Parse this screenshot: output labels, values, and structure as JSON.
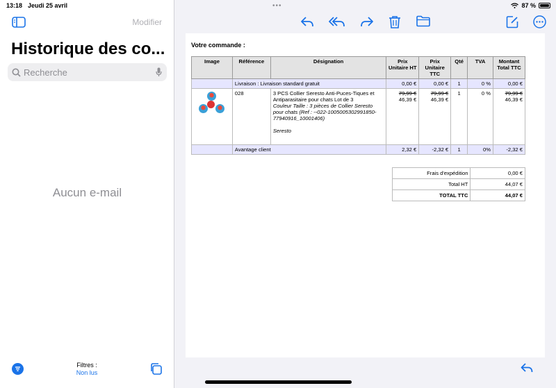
{
  "status": {
    "time": "13:18",
    "date": "Jeudi 25 avril",
    "battery": "87 %"
  },
  "sidebar": {
    "edit_label": "Modifier",
    "title": "Historique des co...",
    "search_placeholder": "Recherche",
    "empty_label": "Aucun e-mail",
    "filters_label": "Filtres :",
    "filters_value": "Non lus"
  },
  "toolbar": {
    "icons": [
      "reply-icon",
      "reply-all-icon",
      "forward-icon",
      "trash-icon",
      "folder-icon",
      "compose-icon",
      "more-icon"
    ],
    "accent": "#1a73e8"
  },
  "order": {
    "title": "Votre commande :",
    "headers": {
      "image": "Image",
      "reference": "Référence",
      "designation": "Désignation",
      "prix_ht": "Prix Unitaire HT",
      "prix_ttc": "Prix Unitaire TTC",
      "qte": "Qté",
      "tva": "TVA",
      "montant": "Montant Total TTC"
    },
    "shipping_row": {
      "label": "Livraison : Livraison standard gratuit",
      "ht": "0,00 €",
      "ttc": "0,00 €",
      "qte": "1",
      "tva": "0 %",
      "total": "0,00 €"
    },
    "product_row": {
      "reference": "028",
      "name": "3 PCS Collier Seresto Anti-Puces-Tiques et Antiparasitaire pour chats Lot de 3",
      "variant": "Couleur Taille : 3 pièces de Collier Seresto pour chats (Ref : --022-1005005302991850-77940916_10001406)",
      "brand": "Seresto",
      "ht_old": "79,99 €",
      "ht_new": "46,39 €",
      "ttc_old": "79,99 €",
      "ttc_new": "46,39 €",
      "qte": "1",
      "tva": "0 %",
      "total_old": "79,99 €",
      "total_new": "46,39 €"
    },
    "discount_row": {
      "label": "Avantage client",
      "ht": "2,32 €",
      "ttc": "-2,32 €",
      "qte": "1",
      "tva": "0%",
      "total": "-2,32 €"
    },
    "totals": [
      {
        "label": "Frais d'expédition",
        "value": "0,00 €"
      },
      {
        "label": "Total HT",
        "value": "44,07 €"
      },
      {
        "label": "TOTAL TTC",
        "value": "44,07 €"
      }
    ]
  }
}
